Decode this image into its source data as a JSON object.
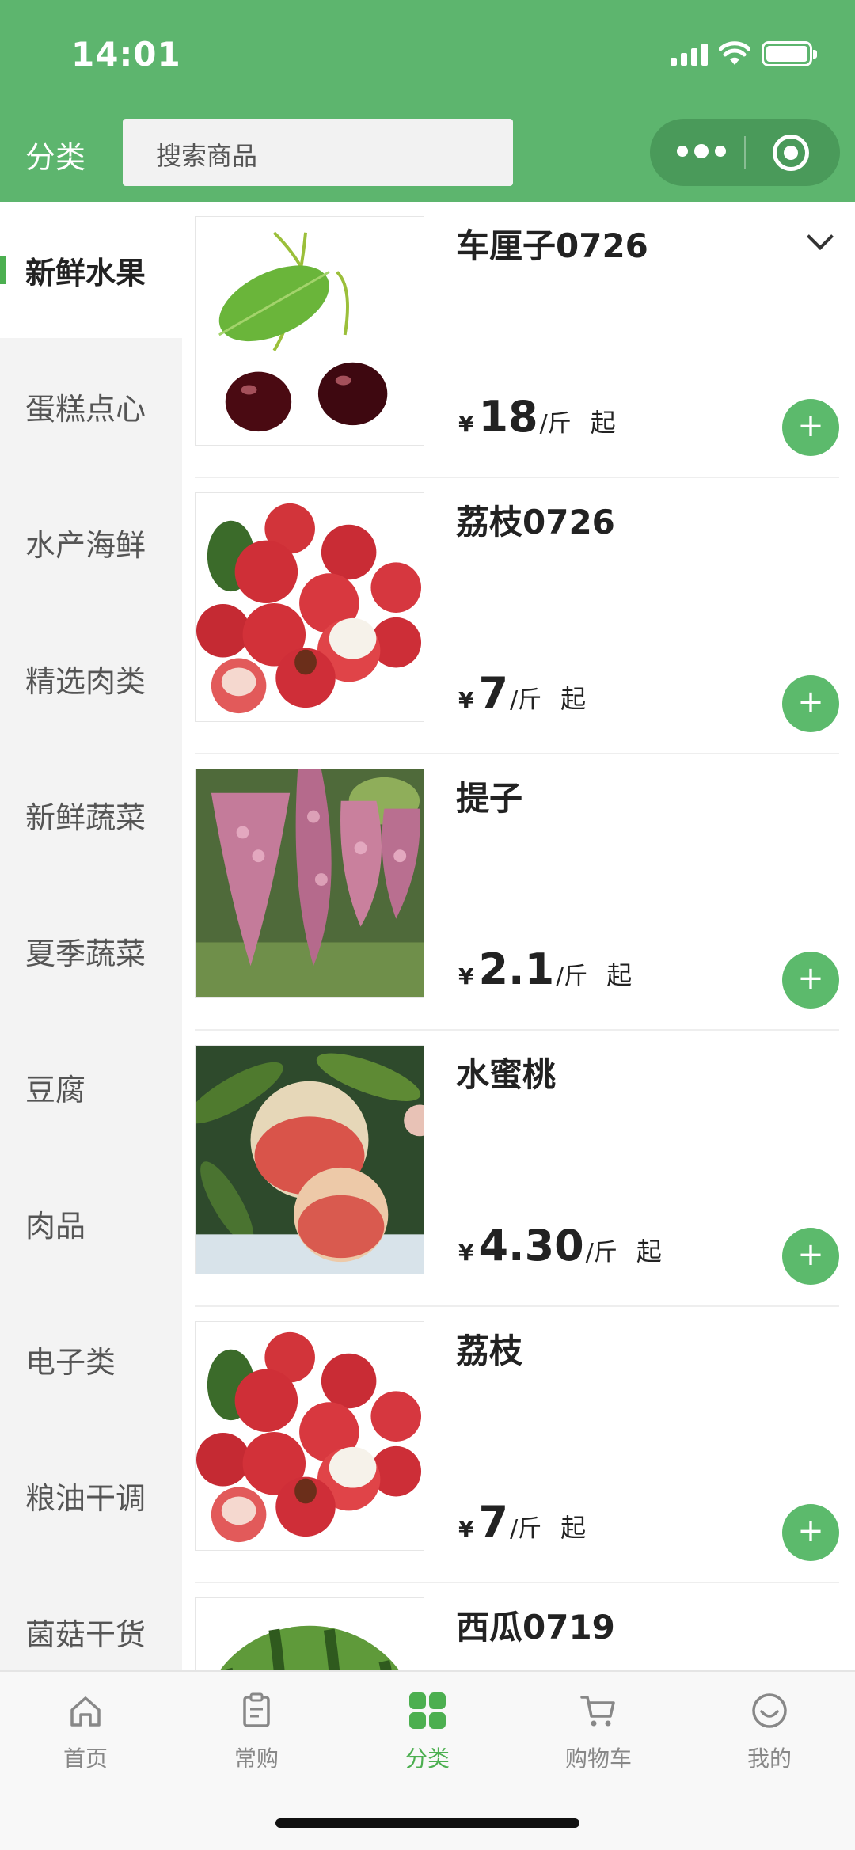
{
  "status_bar": {
    "time": "14:01"
  },
  "header": {
    "title": "分类",
    "search_placeholder": "搜索商品"
  },
  "colors": {
    "brand_green": "#5db56e",
    "accent_green": "#4caf50"
  },
  "sidebar": {
    "categories": [
      {
        "label": "新鲜水果",
        "active": true
      },
      {
        "label": "蛋糕点心",
        "active": false
      },
      {
        "label": "水产海鲜",
        "active": false
      },
      {
        "label": "精选肉类",
        "active": false
      },
      {
        "label": "新鲜蔬菜",
        "active": false
      },
      {
        "label": "夏季蔬菜",
        "active": false
      },
      {
        "label": "豆腐",
        "active": false
      },
      {
        "label": "肉品",
        "active": false
      },
      {
        "label": "电子类",
        "active": false
      },
      {
        "label": "粮油干调",
        "active": false
      },
      {
        "label": "菌菇干货",
        "active": false
      }
    ]
  },
  "products": [
    {
      "name": "车厘子0726",
      "currency": "¥",
      "price": "18",
      "unit": "/斤",
      "suffix": "起",
      "image": "cherry",
      "add_icon": "+"
    },
    {
      "name": "荔枝0726",
      "currency": "¥",
      "price": "7",
      "unit": "/斤",
      "suffix": "起",
      "image": "lychee",
      "add_icon": "+"
    },
    {
      "name": "提子",
      "currency": "¥",
      "price": "2.1",
      "unit": "/斤",
      "suffix": "起",
      "image": "grape",
      "add_icon": "+"
    },
    {
      "name": "水蜜桃",
      "currency": "¥",
      "price": "4.30",
      "unit": "/斤",
      "suffix": "起",
      "image": "peach",
      "add_icon": "+"
    },
    {
      "name": "荔枝",
      "currency": "¥",
      "price": "7",
      "unit": "/斤",
      "suffix": "起",
      "image": "lychee",
      "add_icon": "+"
    },
    {
      "name": "西瓜0719",
      "image": "watermelon"
    }
  ],
  "tabbar": {
    "tabs": [
      {
        "label": "首页",
        "icon": "home-icon",
        "active": false
      },
      {
        "label": "常购",
        "icon": "clipboard-icon",
        "active": false
      },
      {
        "label": "分类",
        "icon": "grid-icon",
        "active": true
      },
      {
        "label": "购物车",
        "icon": "cart-icon",
        "active": false
      },
      {
        "label": "我的",
        "icon": "smile-icon",
        "active": false
      }
    ]
  }
}
